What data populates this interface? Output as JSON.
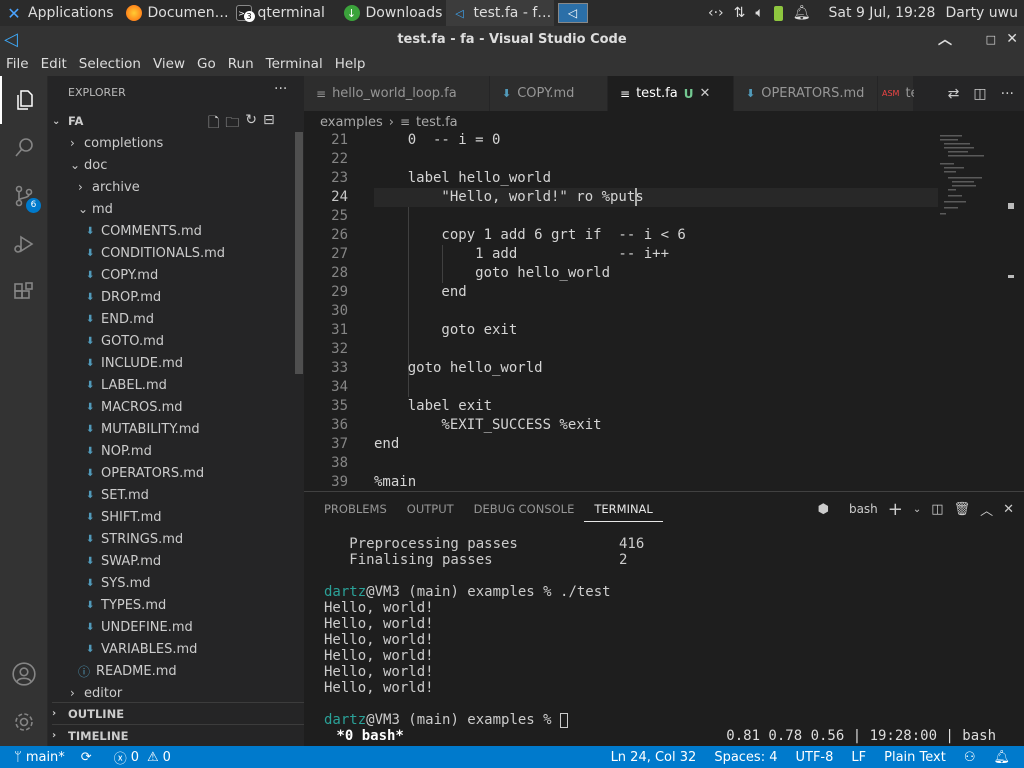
{
  "system_panel": {
    "tasks": [
      {
        "label": "Applications",
        "icon": "xfce-icon"
      },
      {
        "label": "Documen…",
        "icon": "firefox-icon"
      },
      {
        "label": "qterminal",
        "icon": "terminal-icon",
        "badge": "3"
      },
      {
        "label": "Downloads",
        "icon": "download-icon"
      },
      {
        "label": "test.fa - f…",
        "icon": "vscode-icon"
      }
    ],
    "clock": "Sat  9 Jul, 19:28",
    "user": "Darty uwu"
  },
  "window": {
    "title": "test.fa - fa - Visual Studio Code"
  },
  "menu": [
    "File",
    "Edit",
    "Selection",
    "View",
    "Go",
    "Run",
    "Terminal",
    "Help"
  ],
  "activity": {
    "source_control_badge": "6"
  },
  "sidebar": {
    "title": "EXPLORER",
    "more": "···",
    "root": "FA",
    "items": [
      {
        "label": "completions",
        "type": "folder",
        "open": false,
        "depth": 1
      },
      {
        "label": "doc",
        "type": "folder",
        "open": true,
        "depth": 1
      },
      {
        "label": "archive",
        "type": "folder",
        "open": false,
        "depth": 2
      },
      {
        "label": "md",
        "type": "folder",
        "open": true,
        "depth": 2
      },
      {
        "label": "COMMENTS.md",
        "type": "md",
        "depth": 3
      },
      {
        "label": "CONDITIONALS.md",
        "type": "md",
        "depth": 3
      },
      {
        "label": "COPY.md",
        "type": "md",
        "depth": 3
      },
      {
        "label": "DROP.md",
        "type": "md",
        "depth": 3
      },
      {
        "label": "END.md",
        "type": "md",
        "depth": 3
      },
      {
        "label": "GOTO.md",
        "type": "md",
        "depth": 3
      },
      {
        "label": "INCLUDE.md",
        "type": "md",
        "depth": 3
      },
      {
        "label": "LABEL.md",
        "type": "md",
        "depth": 3
      },
      {
        "label": "MACROS.md",
        "type": "md",
        "depth": 3
      },
      {
        "label": "MUTABILITY.md",
        "type": "md",
        "depth": 3
      },
      {
        "label": "NOP.md",
        "type": "md",
        "depth": 3
      },
      {
        "label": "OPERATORS.md",
        "type": "md",
        "depth": 3
      },
      {
        "label": "SET.md",
        "type": "md",
        "depth": 3
      },
      {
        "label": "SHIFT.md",
        "type": "md",
        "depth": 3
      },
      {
        "label": "STRINGS.md",
        "type": "md",
        "depth": 3
      },
      {
        "label": "SWAP.md",
        "type": "md",
        "depth": 3
      },
      {
        "label": "SYS.md",
        "type": "md",
        "depth": 3
      },
      {
        "label": "TYPES.md",
        "type": "md",
        "depth": 3
      },
      {
        "label": "UNDEFINE.md",
        "type": "md",
        "depth": 3
      },
      {
        "label": "VARIABLES.md",
        "type": "md",
        "depth": 3
      },
      {
        "label": "README.md",
        "type": "info",
        "depth": 2
      },
      {
        "label": "editor",
        "type": "folder",
        "open": false,
        "depth": 1
      }
    ],
    "outline": "OUTLINE",
    "timeline": "TIMELINE"
  },
  "tabs": [
    {
      "label": "hello_world_loop.fa",
      "active": false
    },
    {
      "label": "COPY.md",
      "active": false
    },
    {
      "label": "test.fa",
      "active": true,
      "status": "U"
    },
    {
      "label": "OPERATORS.md",
      "active": false
    },
    {
      "label": "te",
      "active": false
    }
  ],
  "breadcrumb": [
    "examples",
    "test.fa"
  ],
  "code_lines": [
    {
      "n": "21",
      "text": "    0  -- i = 0"
    },
    {
      "n": "22",
      "text": ""
    },
    {
      "n": "23",
      "text": "    label hello_world"
    },
    {
      "n": "24",
      "text": "        \"Hello, world!\" ro %puts"
    },
    {
      "n": "25",
      "text": ""
    },
    {
      "n": "26",
      "text": "        copy 1 add 6 grt if  -- i < 6"
    },
    {
      "n": "27",
      "text": "            1 add            -- i++"
    },
    {
      "n": "28",
      "text": "            goto hello_world"
    },
    {
      "n": "29",
      "text": "        end"
    },
    {
      "n": "30",
      "text": ""
    },
    {
      "n": "31",
      "text": "        goto exit"
    },
    {
      "n": "32",
      "text": ""
    },
    {
      "n": "33",
      "text": "    goto hello_world"
    },
    {
      "n": "34",
      "text": ""
    },
    {
      "n": "35",
      "text": "    label exit"
    },
    {
      "n": "36",
      "text": "        %EXIT_SUCCESS %exit"
    },
    {
      "n": "37",
      "text": "end"
    },
    {
      "n": "38",
      "text": ""
    },
    {
      "n": "39",
      "text": "%main"
    }
  ],
  "panel": {
    "tabs": [
      "PROBLEMS",
      "OUTPUT",
      "DEBUG CONSOLE",
      "TERMINAL"
    ],
    "active_tab": "TERMINAL",
    "shell": "bash"
  },
  "terminal_lines": [
    "   Preprocessing passes            416",
    "   Finalising passes               2",
    "",
    "dartz@VM3 (main) examples % ./test",
    "Hello, world!",
    "Hello, world!",
    "Hello, world!",
    "Hello, world!",
    "Hello, world!",
    "Hello, world!",
    "",
    "dartz@VM3 (main) examples % "
  ],
  "tmux": {
    "left": " *0 bash*",
    "right": "0.81 0.78 0.56 | 19:28:00 | bash"
  },
  "status": {
    "branch": "main*",
    "errors": "0",
    "warnings": "0",
    "position": "Ln 24, Col 32",
    "spaces": "Spaces: 4",
    "encoding": "UTF-8",
    "eol": "LF",
    "language": "Plain Text"
  },
  "colors": {
    "accent": "#007acc",
    "prompt_user": "#2aa198",
    "md_icon": "#519aba"
  }
}
